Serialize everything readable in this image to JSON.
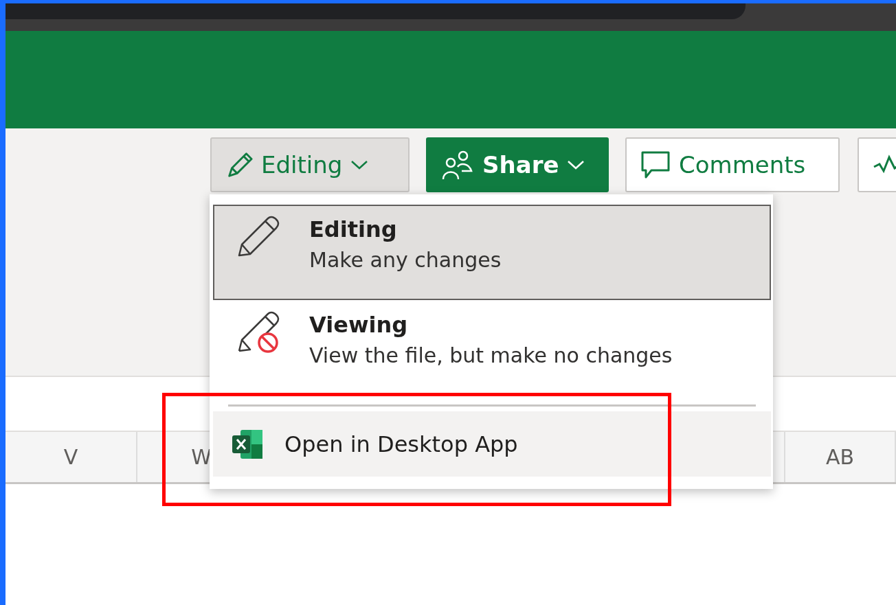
{
  "toolbar": {
    "buttons": [
      {
        "kind": "mode",
        "label": "Editing",
        "expanded": true
      },
      {
        "kind": "share",
        "label": "Share"
      },
      {
        "kind": "comments",
        "label": "Comments"
      },
      {
        "kind": "icon-only"
      }
    ]
  },
  "menu": {
    "items": [
      {
        "kind": "mode",
        "title": "Editing",
        "description": "Make any changes",
        "selected": true
      },
      {
        "kind": "mode-blocked",
        "title": "Viewing",
        "description": "View the file, but make no changes",
        "selected": false
      },
      {
        "kind": "separator"
      },
      {
        "kind": "action",
        "label": "Open in Desktop App",
        "highlighted": true
      }
    ]
  },
  "column_headers": [
    {
      "label": "V"
    },
    {
      "label": "W"
    },
    {
      "label": "AB"
    }
  ]
}
